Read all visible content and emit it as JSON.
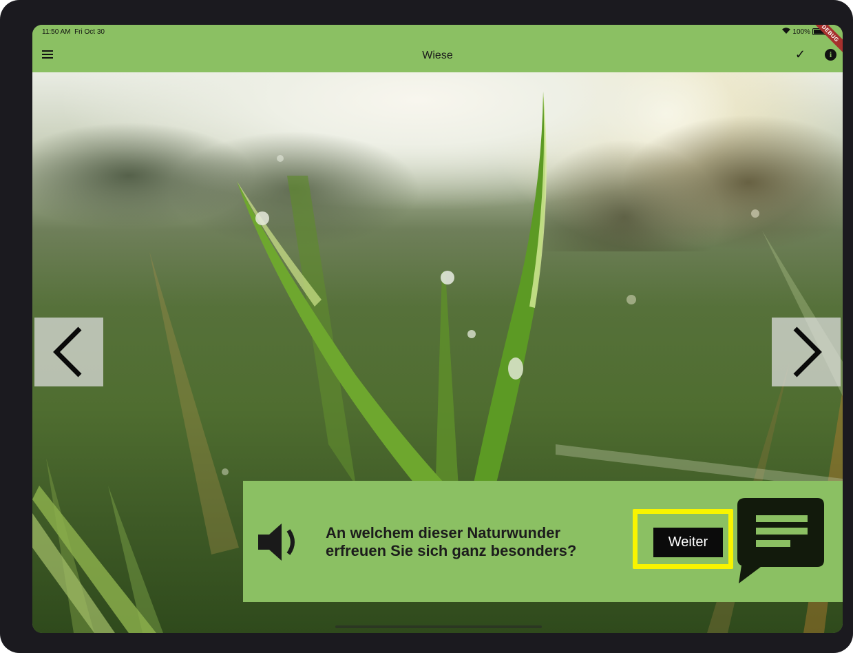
{
  "status_bar": {
    "time": "11:50 AM",
    "date": "Fri Oct 30",
    "battery": "100%",
    "debug_ribbon": "DEBUG"
  },
  "app_bar": {
    "title": "Wiese",
    "menu_icon": "hamburger-menu-icon",
    "check_icon": "checkmark-icon",
    "info_icon": "info-icon",
    "color": "#8bc063"
  },
  "prompt": {
    "line1": "An welchem dieser Naturwunder",
    "line2": "erfreuen Sie sich ganz besonders?",
    "button_label": "Weiter",
    "speaker_icon": "speaker-icon",
    "chat_icon": "speech-bubble-icon",
    "highlight_color": "#f8f400"
  },
  "navigation": {
    "prev_icon": "chevron-left-icon",
    "next_icon": "chevron-right-icon"
  },
  "photo": {
    "subject": "grass-with-dew-drops"
  }
}
